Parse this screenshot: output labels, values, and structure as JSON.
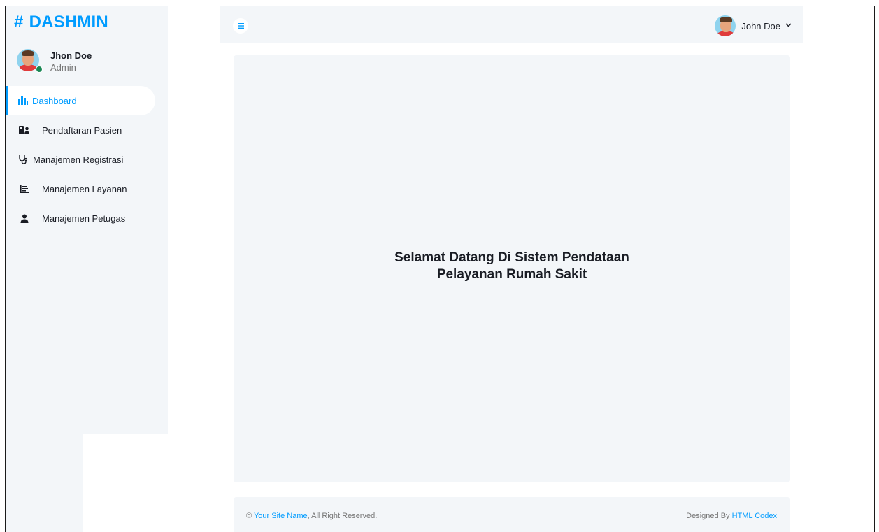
{
  "brand": {
    "symbol": "#",
    "name": "DASHMIN",
    "color": "#009cff"
  },
  "sidebar_user": {
    "name": "Jhon Doe",
    "role": "Admin",
    "status_color": "#198754"
  },
  "nav": [
    {
      "label": "Dashboard",
      "icon": "dashboard-icon",
      "active": true
    },
    {
      "label": "Pendaftaran Pasien",
      "icon": "patient-registration-icon",
      "active": false
    },
    {
      "label": "Manajemen Registrasi",
      "icon": "stethoscope-icon",
      "active": false
    },
    {
      "label": "Manajemen Layanan",
      "icon": "list-chart-icon",
      "active": false
    },
    {
      "label": "Manajemen Petugas",
      "icon": "user-icon",
      "active": false
    }
  ],
  "topbar": {
    "toggle_icon": "menu-icon",
    "user_name": "John Doe",
    "dropdown_icon": "chevron-down-icon"
  },
  "main": {
    "welcome_line1": "Selamat Datang Di Sistem Pendataan",
    "welcome_line2": "Pelayanan Rumah Sakit"
  },
  "footer": {
    "copyright_symbol": "©",
    "site_link": "Your Site Name",
    "rights": ", All Right Reserved.",
    "designed_by": "Designed By",
    "designer_link": "HTML Codex"
  }
}
